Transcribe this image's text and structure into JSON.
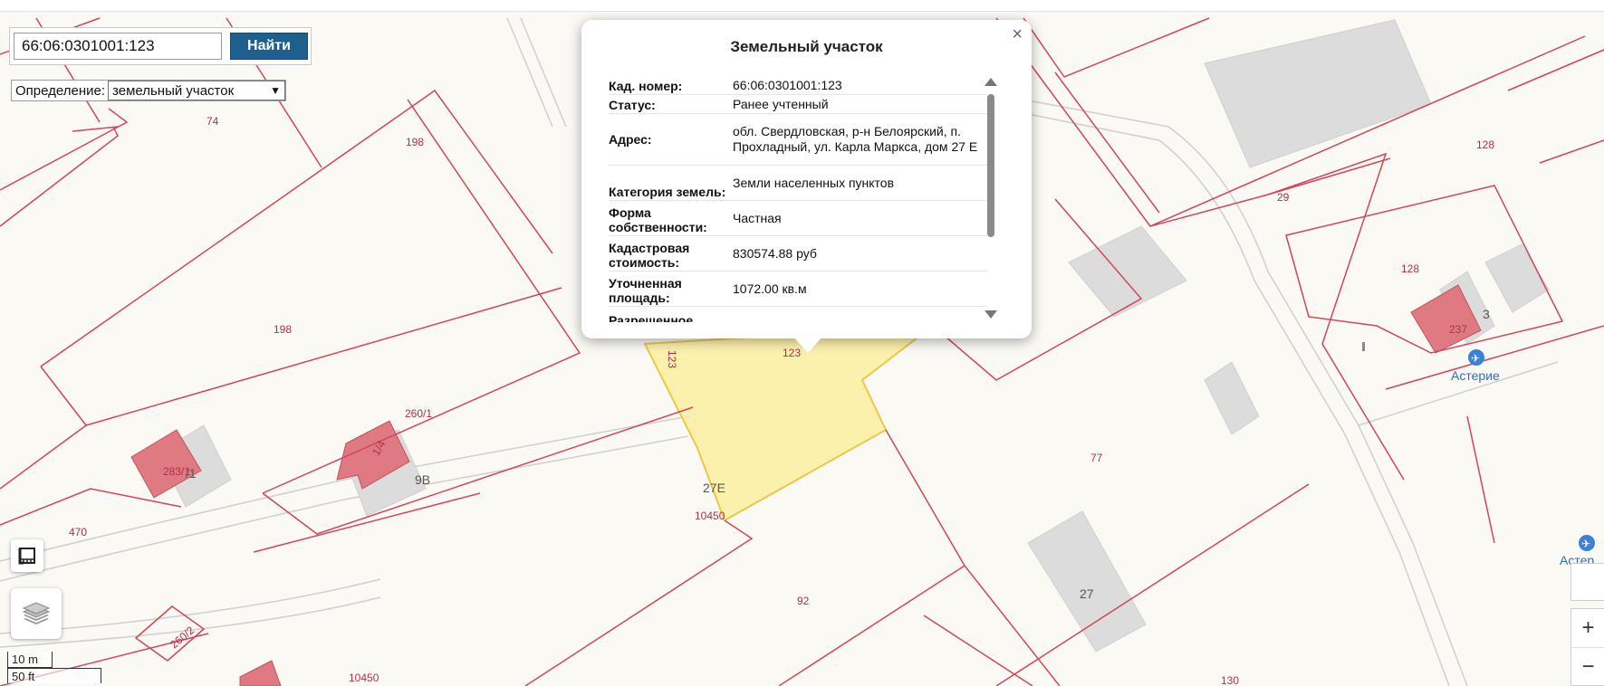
{
  "search": {
    "value": "66:06:0301001:123",
    "button_label": "Найти"
  },
  "definition": {
    "label": "Определение:",
    "selected": "земельный участок"
  },
  "popup": {
    "title": "Земельный участок",
    "close_symbol": "×",
    "rows": [
      {
        "key": "Кад. номер:",
        "value": "66:06:0301001:123"
      },
      {
        "key": "Статус:",
        "value": "Ранее учтенный"
      },
      {
        "key": "Адрес:",
        "value": "обл. Свердловская, р-н Белоярский, п. Прохладный, ул. Карла Маркса, дом 27 Е"
      },
      {
        "key": "Категория земель:",
        "value": "Земли населенных пунктов"
      },
      {
        "key": "Форма собственности:",
        "value": "Частная"
      },
      {
        "key": "Кадастровая стоимость:",
        "value": "830574.88 руб"
      },
      {
        "key": "Уточненная площадь:",
        "value": "1072.00 кв.м"
      },
      {
        "key": "Разрешенное",
        "value": ""
      }
    ]
  },
  "map": {
    "parcel_labels": [
      "74",
      "198",
      "198",
      "260/1",
      "283/1",
      "1/4",
      "470",
      "260/2",
      "10450",
      "10450",
      "92",
      "77",
      "27Е",
      "123",
      "123",
      "29",
      "128",
      "128",
      "237",
      "130"
    ],
    "house_labels": [
      "9В",
      "27",
      "27Е",
      "/1",
      "3"
    ],
    "poi": {
      "name": "Астерие",
      "name_clipped": "Астер"
    },
    "colors": {
      "background": "#fbf9f4",
      "parcel_border": "#d2455a",
      "selected_fill": "#fbeea0",
      "selected_border": "#e8c94a",
      "building": "#dcdcdc",
      "building_red": "#e07a82",
      "road": "#c9c9c9"
    }
  },
  "scale": {
    "metric": "10 m",
    "imperial": "50 ft"
  },
  "zoom": {
    "in_label": "+",
    "out_label": "−"
  }
}
